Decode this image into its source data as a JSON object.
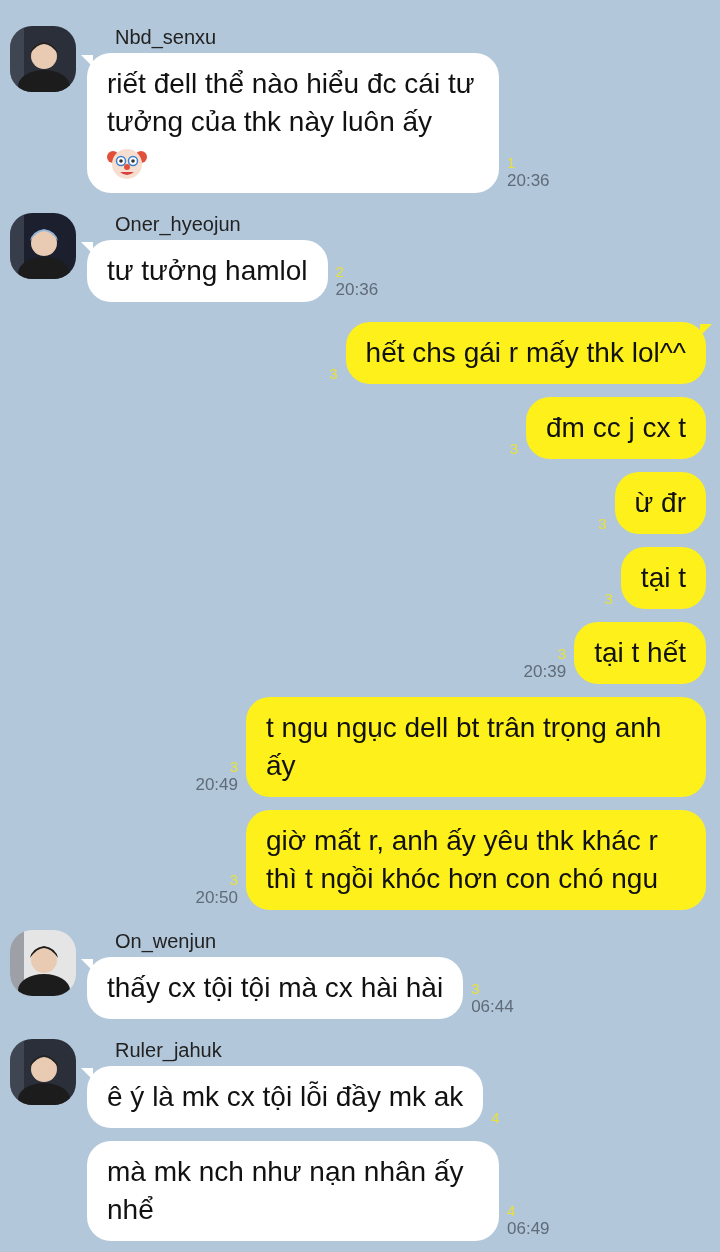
{
  "conversation": [
    {
      "kind": "incoming",
      "sender": "Nbd_senxu",
      "bubbles": [
        {
          "text": "riết đell thể nào hiểu đc cái tư tưởng của thk này luôn ấy",
          "emoji": true,
          "unread": "1",
          "time": "20:36"
        }
      ]
    },
    {
      "kind": "incoming",
      "sender": "Oner_hyeojun",
      "bubbles": [
        {
          "text": "tư tưởng hamlol",
          "unread": "2",
          "time": "20:36"
        }
      ]
    },
    {
      "kind": "outgoing",
      "bubbles": [
        {
          "text": "hết chs gái r mấy thk lol^^",
          "unread": "3"
        },
        {
          "text": "đm cc j cx t",
          "unread": "3"
        },
        {
          "text": "ừ đr",
          "unread": "3"
        },
        {
          "text": "tại t",
          "unread": "3"
        },
        {
          "text": "tại t hết",
          "unread": "3",
          "time": "20:39"
        },
        {
          "text": "t ngu ngục dell bt trân trọng anh ấy",
          "unread": "3",
          "time": "20:49"
        },
        {
          "text": "giờ mất r, anh ấy yêu thk khác r thì t ngồi khóc hơn con chó ngu",
          "unread": "3",
          "time": "20:50"
        }
      ]
    },
    {
      "kind": "incoming",
      "sender": "On_wenjun",
      "bubbles": [
        {
          "text": "thấy cx tội tội mà cx hài hài",
          "unread": "3",
          "time": "06:44"
        }
      ]
    },
    {
      "kind": "incoming",
      "sender": "Ruler_jahuk",
      "bubbles": [
        {
          "text": "ê ý là mk cx tội lỗi đầy mk ak",
          "unread": "4"
        },
        {
          "text": "mà mk nch như nạn nhân ấy nhể",
          "unread": "4",
          "time": "06:49"
        }
      ]
    }
  ]
}
